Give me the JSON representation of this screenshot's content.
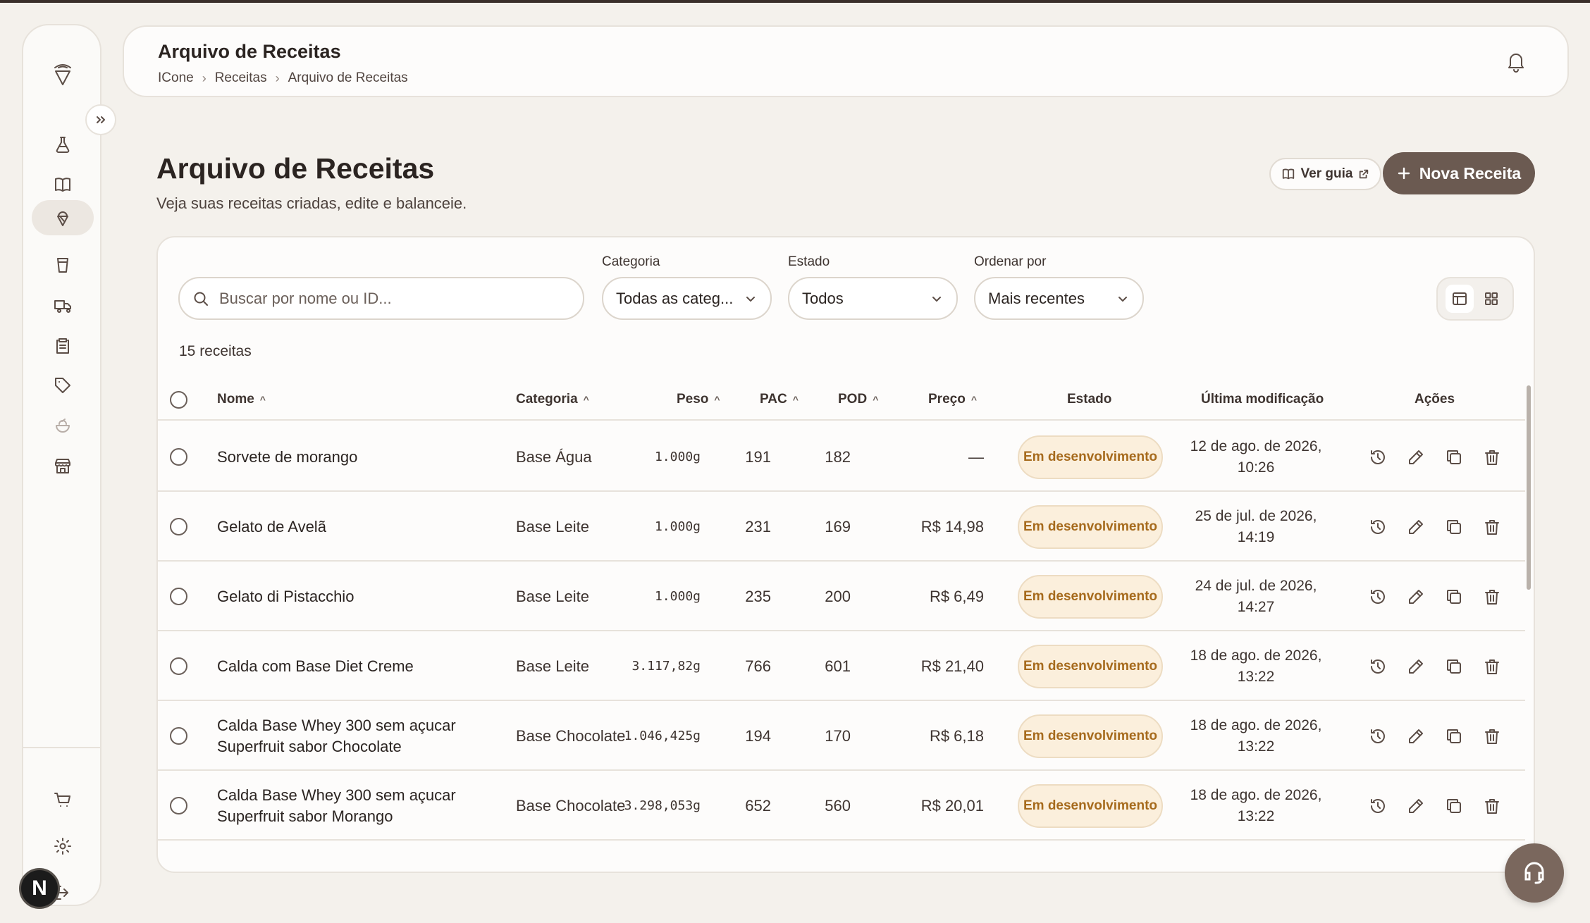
{
  "app": {
    "name": "ICone"
  },
  "header": {
    "title": "Arquivo de Receitas",
    "breadcrumb": [
      "ICone",
      "Receitas",
      "Arquivo de Receitas"
    ]
  },
  "page": {
    "title": "Arquivo de Receitas",
    "subtitle": "Veja suas receitas criadas, edite e balanceie.",
    "guide_label": "Ver guia",
    "new_label": "Nova Receita"
  },
  "sidebar": {
    "items": [
      {
        "name": "flask-icon",
        "active": false
      },
      {
        "name": "book-icon",
        "active": false
      },
      {
        "name": "ice-cream-icon",
        "active": true
      },
      {
        "name": "cup-icon",
        "active": false
      },
      {
        "name": "truck-icon",
        "active": false
      },
      {
        "name": "clipboard-icon",
        "active": false
      },
      {
        "name": "tag-icon",
        "active": false
      },
      {
        "name": "bowl-icon",
        "active": false
      },
      {
        "name": "store-icon",
        "active": false
      }
    ],
    "bottom": [
      "cart-icon",
      "gear-icon",
      "logout-icon"
    ],
    "avatar": "N"
  },
  "filters": {
    "search_placeholder": "Buscar por nome ou ID...",
    "categoria_label": "Categoria",
    "categoria_value": "Todas as categ...",
    "estado_label": "Estado",
    "estado_value": "Todos",
    "ordenar_label": "Ordenar por",
    "ordenar_value": "Mais recentes"
  },
  "count_text": "15 receitas",
  "table": {
    "columns": {
      "nome": "Nome",
      "categoria": "Categoria",
      "peso": "Peso",
      "pac": "PAC",
      "pod": "POD",
      "preco": "Preço",
      "estado": "Estado",
      "modificacao": "Última modificação",
      "acoes": "Ações"
    },
    "rows": [
      {
        "name": "Sorvete de morango",
        "category": "Base Água",
        "weight": "1.000g",
        "pac": "191",
        "pod": "182",
        "price": "—",
        "status": "Em desenvolvimento",
        "date": "12 de ago. de 2026, 10:26"
      },
      {
        "name": "Gelato de Avelã",
        "category": "Base Leite",
        "weight": "1.000g",
        "pac": "231",
        "pod": "169",
        "price": "R$ 14,98",
        "status": "Em desenvolvimento",
        "date": "25 de jul. de 2026, 14:19"
      },
      {
        "name": "Gelato di Pistacchio",
        "category": "Base Leite",
        "weight": "1.000g",
        "pac": "235",
        "pod": "200",
        "price": "R$ 6,49",
        "status": "Em desenvolvimento",
        "date": "24 de jul. de 2026, 14:27"
      },
      {
        "name": "Calda com Base Diet Creme",
        "category": "Base Leite",
        "weight": "3.117,82g",
        "pac": "766",
        "pod": "601",
        "price": "R$ 21,40",
        "status": "Em desenvolvimento",
        "date": "18 de ago. de 2026, 13:22"
      },
      {
        "name": "Calda Base Whey 300 sem açucar Superfruit sabor Chocolate",
        "category": "Base Chocolate",
        "weight": "1.046,425g",
        "pac": "194",
        "pod": "170",
        "price": "R$ 6,18",
        "status": "Em desenvolvimento",
        "date": "18 de ago. de 2026, 13:22"
      },
      {
        "name": "Calda Base Whey 300 sem açucar Superfruit sabor Morango",
        "category": "Base Chocolate",
        "weight": "3.298,053g",
        "pac": "652",
        "pod": "560",
        "price": "R$ 20,01",
        "status": "Em desenvolvimento",
        "date": "18 de ago. de 2026, 13:22"
      }
    ]
  },
  "colors": {
    "primary": "#6b5a51",
    "badge_bg": "#fbefdc",
    "badge_text": "#a66a1c",
    "background": "#f4f1ec"
  }
}
